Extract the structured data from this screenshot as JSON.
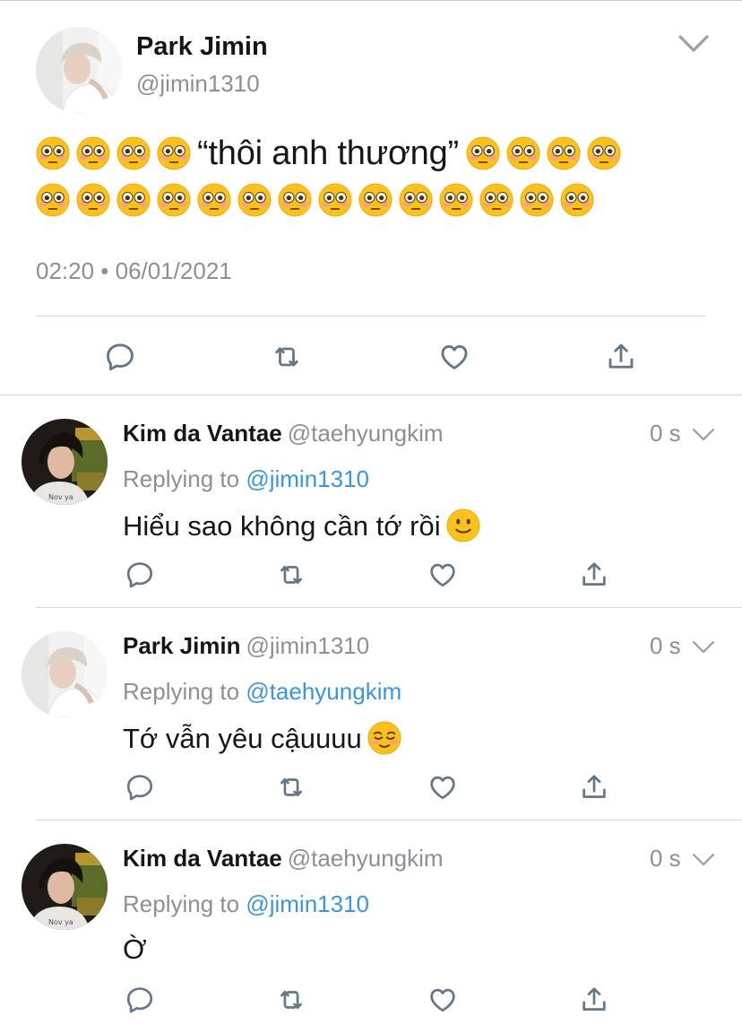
{
  "main_tweet": {
    "author_name": "Park Jimin",
    "author_handle": "@jimin1310",
    "text_before_quote": "“thôi anh thương”",
    "leading_emoji_count": 4,
    "trailing_emoji_count_line1": 4,
    "trailing_emoji_count_line2": 14,
    "emoji_name": "flushed-face",
    "timestamp": "02:20 • 06/01/2021"
  },
  "replies": [
    {
      "author_name": "Kim da Vantae",
      "author_handle": "@taehyungkim",
      "time": "0 s",
      "replying_label": "Replying to",
      "replying_to": "@jimin1310",
      "text": "Hiểu sao không cần tớ rồi",
      "emoji": "slightly-smiling-face",
      "avatar": "dark-hair"
    },
    {
      "author_name": "Park Jimin",
      "author_handle": "@jimin1310",
      "time": "0 s",
      "replying_label": "Replying to",
      "replying_to": "@taehyungkim",
      "text": "Tớ vẫn yêu cậuuuu",
      "emoji": "relieved-face",
      "avatar": "light-hair"
    },
    {
      "author_name": "Kim da Vantae",
      "author_handle": "@taehyungkim",
      "time": "0 s",
      "replying_label": "Replying to",
      "replying_to": "@jimin1310",
      "text": "Ờ",
      "emoji": "",
      "avatar": "dark-hair"
    }
  ],
  "colors": {
    "link": "#3a95e0",
    "muted": "#8a9096",
    "icon": "#657786",
    "divider": "#d6d9dc"
  },
  "icons": [
    "reply-icon",
    "retweet-icon",
    "like-icon",
    "share-icon",
    "chevron-down-icon"
  ]
}
